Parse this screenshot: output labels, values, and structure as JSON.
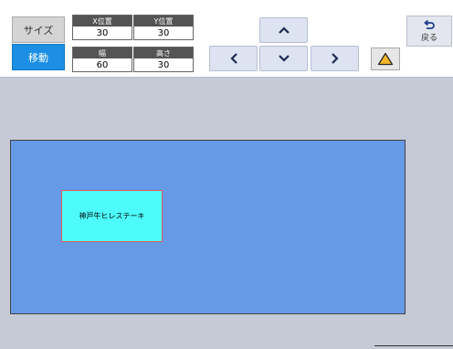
{
  "mode_buttons": {
    "size": "サイズ",
    "move": "移動"
  },
  "fields": {
    "x": {
      "label": "X位置",
      "value": "30"
    },
    "y": {
      "label": "Y位置",
      "value": "30"
    },
    "width": {
      "label": "幅",
      "value": "60"
    },
    "height": {
      "label": "高さ",
      "value": "30"
    }
  },
  "arrows": {
    "up": "chevron-up-icon",
    "left": "chevron-left-icon",
    "down": "chevron-down-icon",
    "right": "chevron-right-icon"
  },
  "back_button": {
    "label": "戻る",
    "icon": "return-arrow-icon"
  },
  "warning_icon": "warning-triangle-icon",
  "canvas": {
    "item_label": "神戸牛ヒレステーキ"
  },
  "colors": {
    "active_mode": "#1c8fe4",
    "canvas_bg": "#6699e6",
    "item_bg": "#4dfcfa",
    "item_border": "#e05a5a",
    "warning": "#f5b82a"
  }
}
